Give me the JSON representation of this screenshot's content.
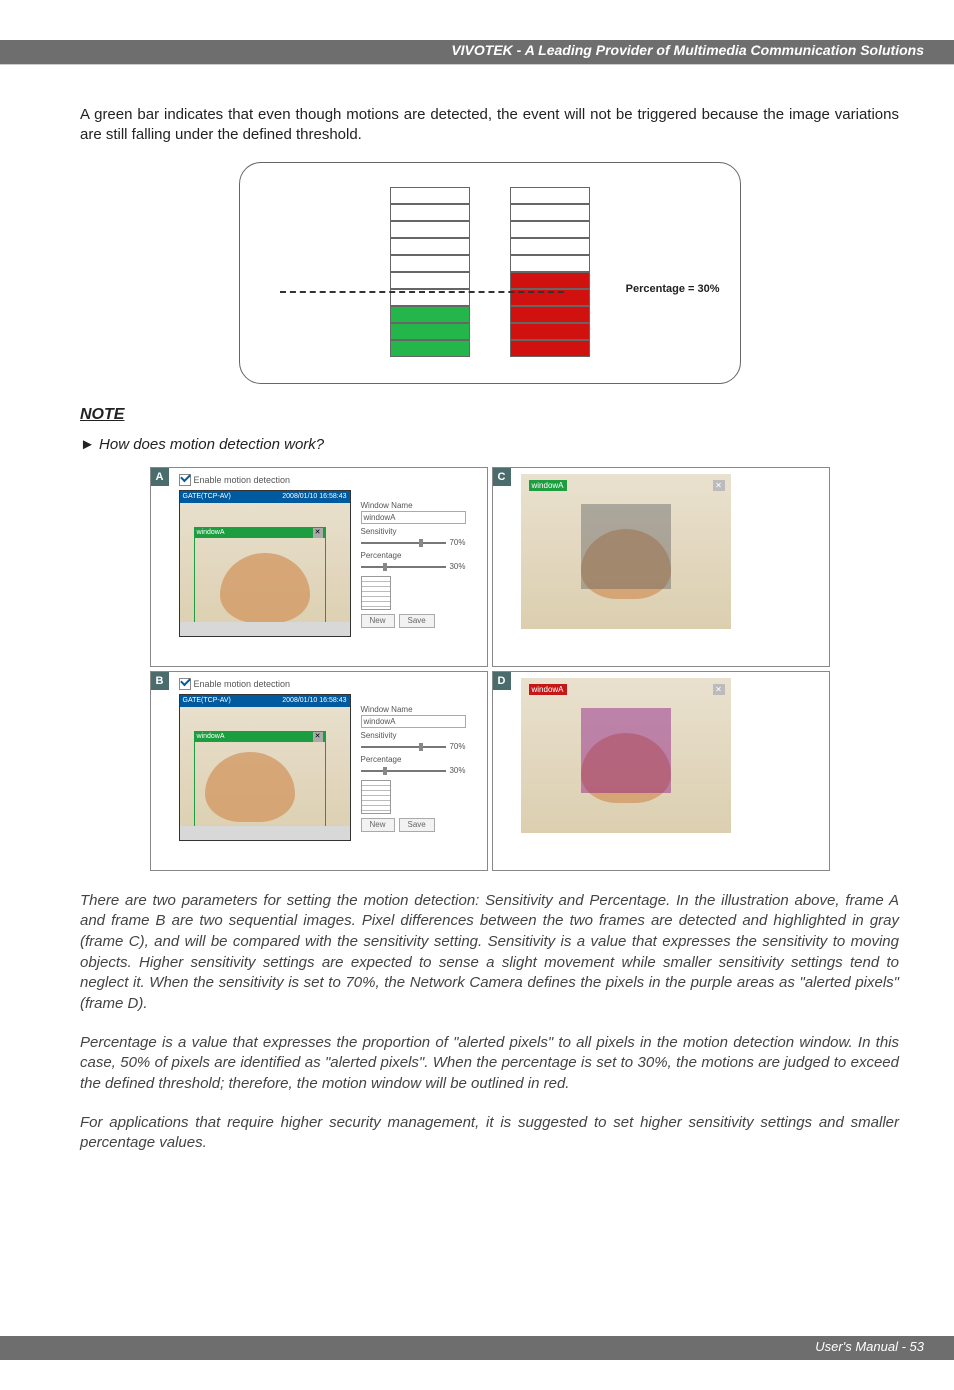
{
  "header": {
    "title": "VIVOTEK - A Leading Provider of Multimedia Communication Solutions"
  },
  "intro": "A green bar indicates that even though motions are detected, the event will not be triggered because the image variations are still falling under the defined threshold.",
  "chart_data": {
    "type": "bar",
    "series_green": {
      "filled": 3,
      "total": 10
    },
    "series_red": {
      "filled": 5,
      "total": 10
    },
    "threshold_label": "Percentage = 30%",
    "threshold_value": 30
  },
  "note": {
    "heading": "NOTE",
    "question": "► How does motion detection work?"
  },
  "panels": {
    "A": {
      "label": "A",
      "checkbox": "Enable motion detection",
      "video_title_left": "GATE(TCP-AV)",
      "video_title_right": "2008/01/10 16:58:43",
      "inner_win": "windowA",
      "close": "✕"
    },
    "B": {
      "label": "B",
      "checkbox": "Enable motion detection",
      "video_title_left": "GATE(TCP-AV)",
      "video_title_right": "2008/01/10 16:58:43",
      "inner_win": "windowA",
      "close": "✕"
    },
    "C": {
      "label": "C",
      "window": "windowA",
      "close": "✕"
    },
    "D": {
      "label": "D",
      "window": "windowA",
      "close": "✕"
    }
  },
  "controls": {
    "window_name_label": "Window Name",
    "window_name_value": "windowA",
    "sensitivity_label": "Sensitivity",
    "sensitivity_value": "70%",
    "percentage_label": "Percentage",
    "percentage_value": "30%",
    "btn_new": "New",
    "btn_save": "Save"
  },
  "para1": "There are two parameters for setting the motion detection: Sensitivity and Percentage. In the illustration above, frame A and frame B are two sequential images. Pixel differences between the two frames are detected and highlighted in gray (frame C), and will be compared with the sensitivity setting. Sensitivity is a value that expresses the sensitivity to moving objects. Higher sensitivity settings are expected to sense a slight movement while smaller sensitivity settings tend to neglect it. When the sensitivity is set to 70%, the Network Camera defines the pixels in the purple areas as \"alerted pixels\" (frame D).",
  "para2": "Percentage is a value that expresses the proportion of \"alerted pixels\" to all pixels in the motion detection window. In this case, 50% of pixels are identified as \"alerted pixels\". When the percentage is set to 30%, the motions are judged to exceed the defined threshold; therefore, the motion window will be outlined in red.",
  "para3": "For applications that require higher security management, it is suggested to set higher sensitivity settings and smaller percentage values.",
  "footer": {
    "text": "User's Manual - 53"
  }
}
